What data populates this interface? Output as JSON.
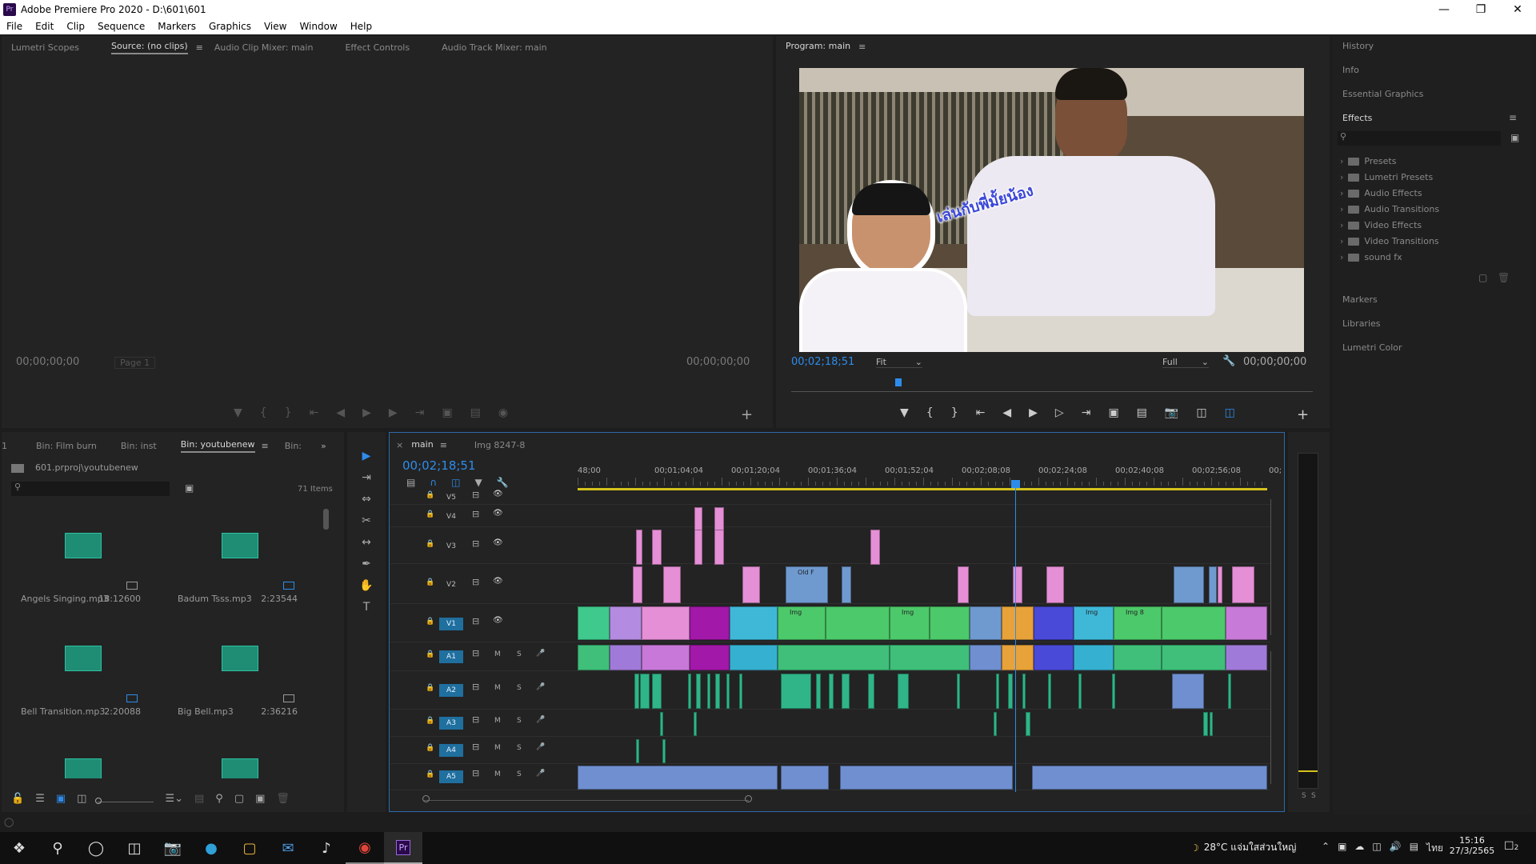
{
  "window": {
    "title": "Adobe Premiere Pro 2020 - D:\\601\\601",
    "app_icon": "Pr"
  },
  "menu": [
    "File",
    "Edit",
    "Clip",
    "Sequence",
    "Markers",
    "Graphics",
    "View",
    "Window",
    "Help"
  ],
  "source_panel": {
    "tabs": [
      "Lumetri Scopes",
      "Source: (no clips)",
      "Audio Clip Mixer: main",
      "Effect Controls",
      "Audio Track Mixer: main"
    ],
    "active_tab": "Source: (no clips)",
    "tc_left": "00;00;00;00",
    "page": "Page 1",
    "tc_right": "00;00;00;00"
  },
  "program_panel": {
    "title": "Program: main",
    "tc_current": "00;02;18;51",
    "fit": "Fit",
    "quality": "Full",
    "tc_duration": "00;00;00;00",
    "overlay_text": "เล่นกับพี่มั้ยน้อง",
    "playhead_frac": 0.206
  },
  "right_panel": {
    "items": [
      "History",
      "Info",
      "Essential Graphics",
      "Effects"
    ],
    "effects_folders": [
      "Presets",
      "Lumetri Presets",
      "Audio Effects",
      "Audio Transitions",
      "Video Effects",
      "Video Transitions",
      "sound fx"
    ],
    "bottom_items": [
      "Markers",
      "Libraries",
      "Lumetri Color"
    ]
  },
  "project_panel": {
    "tabs": [
      "1",
      "Bin: Film burn",
      "Bin: inst",
      "Bin: youtubenew",
      "Bin:"
    ],
    "active_tab": "Bin: youtubenew",
    "path": "601.prproj\\youtubenew",
    "count": "71 Items",
    "items": [
      {
        "name": "Angels Singing.mp3",
        "duration": "18:12600"
      },
      {
        "name": "Badum Tsss.mp3",
        "duration": "2:23544"
      },
      {
        "name": "Bell Transition.mp3",
        "duration": "2:20088"
      },
      {
        "name": "Big Bell.mp3",
        "duration": "2:36216"
      }
    ]
  },
  "timeline": {
    "tabs": [
      "main",
      "Img 8247-8"
    ],
    "active_tab": "main",
    "timecode": "00;02;18;51",
    "ruler": [
      "48;00",
      "00;01;04;04",
      "00;01;20;04",
      "00;01;36;04",
      "00;01;52;04",
      "00;02;08;08",
      "00;02;24;08",
      "00;02;40;08",
      "00;02;56;08",
      "00;"
    ],
    "video_tracks": [
      "V5",
      "V4",
      "V3",
      "V2",
      "V1"
    ],
    "audio_tracks": [
      "A1",
      "A2",
      "A3",
      "A4",
      "A5"
    ],
    "mute_label": "M",
    "solo_label": "S",
    "clip_labels": {
      "old_f": "Old F",
      "img": "Img",
      "img8": "Img 8"
    },
    "playhead_frac": 0.635
  },
  "meters": {
    "labels": [
      "S",
      "S"
    ]
  },
  "taskbar": {
    "weather": "28°C แจ่มใสส่วนใหญ่",
    "lang": "ไทย",
    "time": "15:16",
    "date": "27/3/2565",
    "notif": "2"
  },
  "colors": {
    "accent": "#2d8ceb",
    "video_pink": "#e58fd6",
    "video_green": "#4cc96a",
    "audio_green": "#3fbf7a",
    "audio_blue": "#6f8fd0",
    "playhead": "#2d8ceb"
  }
}
